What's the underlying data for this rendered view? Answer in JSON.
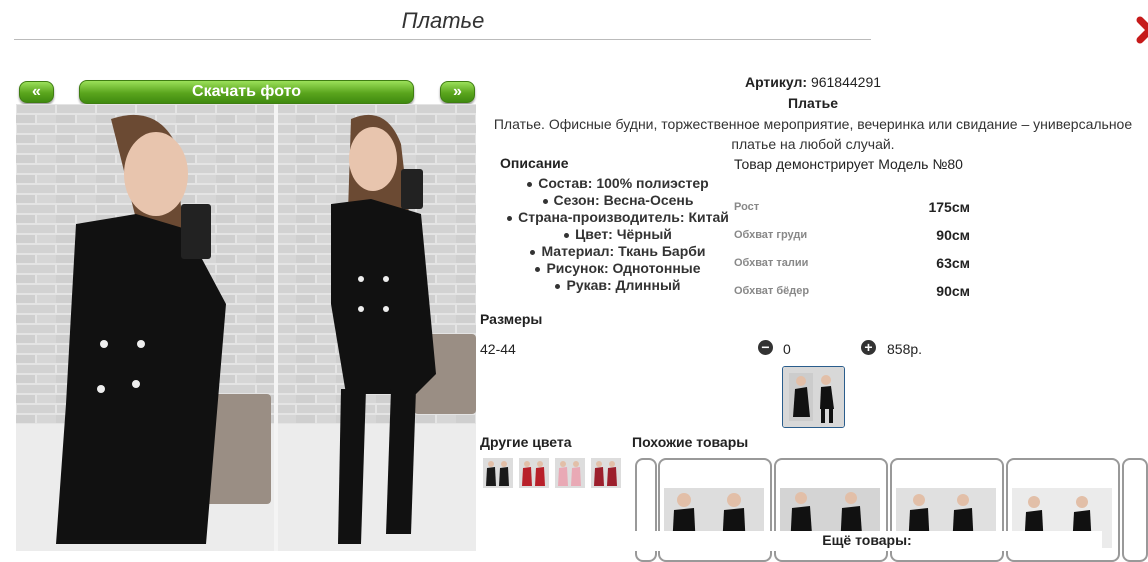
{
  "page": {
    "title": "Платье"
  },
  "gallery": {
    "prev": "«",
    "download": "Скачать фото",
    "next": "»"
  },
  "product": {
    "article_label": "Артикул:",
    "article": "961844291",
    "name": "Платье",
    "description": "Платье. Офисные будни, торжественное мероприятие, вечеринка или свидание – универсальное платье на любой случай."
  },
  "specs": {
    "heading": "Описание",
    "items": [
      "Состав: 100% полиэстер",
      "Сезон: Весна-Осень",
      "Страна-производитель: Китай",
      "Цвет: Чёрный",
      "Материал: Ткань Барби",
      "Рисунок: Однотонные",
      "Рукав: Длинный"
    ]
  },
  "model": {
    "caption": "Товар демонстрирует Модель №80",
    "rows": [
      {
        "label": "Рост",
        "value": "175см"
      },
      {
        "label": "Обхват груди",
        "value": "90см"
      },
      {
        "label": "Обхват талии",
        "value": "63см"
      },
      {
        "label": "Обхват бёдер",
        "value": "90см"
      }
    ]
  },
  "sizes": {
    "heading": "Размеры",
    "size": "42-44",
    "quantity": "0",
    "price": "858р."
  },
  "other_colors": {
    "heading": "Другие цвета",
    "colors": [
      "#1a1a1a",
      "#b8202a",
      "#e9a9b5",
      "#9c1f2c"
    ]
  },
  "similar": {
    "heading": "Похожие товары",
    "more": "Ещё товары:"
  },
  "icons": {
    "close": "close-icon",
    "minus": "minus-circle-icon",
    "plus": "plus-circle-icon"
  }
}
